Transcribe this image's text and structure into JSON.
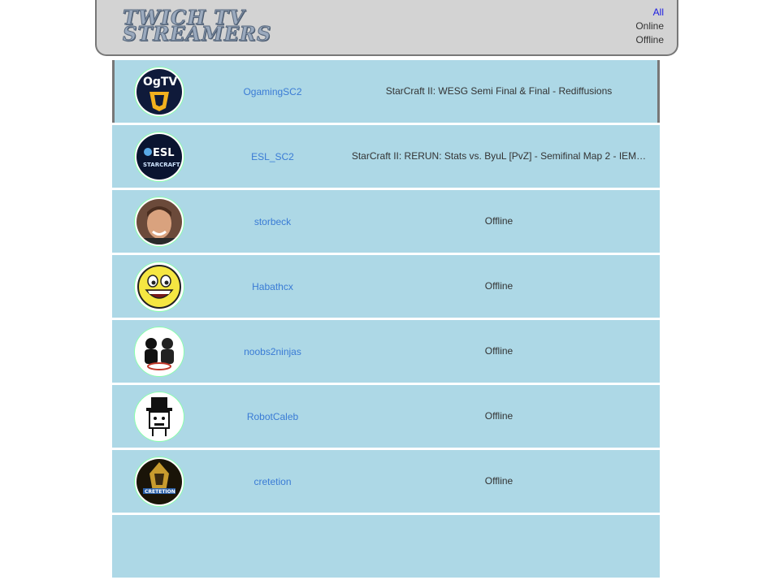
{
  "header": {
    "logo_line1": "TWICH TV",
    "logo_line2": "STREAMERS",
    "filters": {
      "all": "All",
      "online": "Online",
      "offline": "Offline"
    }
  },
  "streamers": [
    {
      "name": "OgamingSC2",
      "status": "StarCraft II: WESG Semi Final & Final - Rediffusions",
      "avatar_icon": "ogtv-logo-icon"
    },
    {
      "name": "ESL_SC2",
      "status": "StarCraft II: RERUN: Stats vs. ByuL [PvZ] - Semifinal Map 2 - IEM…",
      "avatar_icon": "esl-starcraft-logo-icon"
    },
    {
      "name": "storbeck",
      "status": "Offline",
      "avatar_icon": "person-photo-icon"
    },
    {
      "name": "Habathcx",
      "status": "Offline",
      "avatar_icon": "smiley-face-icon"
    },
    {
      "name": "noobs2ninjas",
      "status": "Offline",
      "avatar_icon": "ninjas-logo-icon"
    },
    {
      "name": "RobotCaleb",
      "status": "Offline",
      "avatar_icon": "top-hat-robot-icon"
    },
    {
      "name": "cretetion",
      "status": "Offline",
      "avatar_icon": "cretetion-logo-icon"
    }
  ],
  "colors": {
    "row_bg": "#add8e6",
    "header_bg": "#d3d3d3",
    "link": "#3a7bd5",
    "active_filter": "#1a1ae0"
  }
}
